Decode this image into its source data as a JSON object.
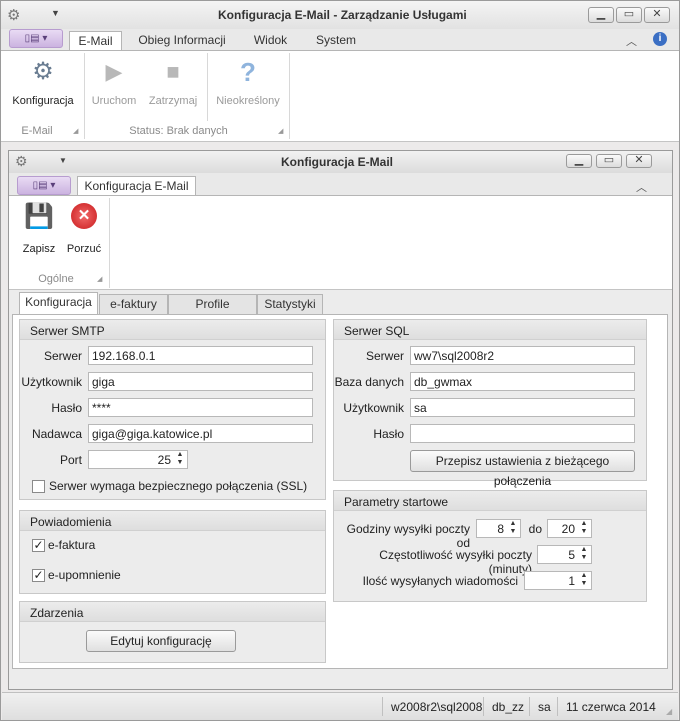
{
  "window": {
    "title_plain": "Konfiguracja E-Mail - ",
    "title_bold": "Zarządzanie Usługami"
  },
  "ribbon": {
    "tabs": [
      "E-Mail",
      "Obieg Informacji",
      "Widok",
      "System"
    ],
    "buttons": {
      "konfiguracja": "Konfiguracja",
      "uruchom": "Uruchom",
      "zatrzymaj": "Zatrzymaj",
      "nieokreslony": "Nieokreślony"
    },
    "groups": {
      "email": "E-Mail",
      "status": "Status: Brak danych"
    }
  },
  "child": {
    "title": "Konfiguracja E-Mail",
    "tab": "Konfiguracja E-Mail",
    "buttons": {
      "zapisz": "Zapisz",
      "porzuc": "Porzuć"
    },
    "group": "Ogólne"
  },
  "content_tabs": [
    "Konfiguracja",
    "e-faktury",
    "Profile upomnień",
    "Statystyki"
  ],
  "smtp": {
    "title": "Serwer SMTP",
    "labels": {
      "server": "Serwer",
      "user": "Użytkownik",
      "password": "Hasło",
      "sender": "Nadawca",
      "port": "Port"
    },
    "server": "192.168.0.1",
    "user": "giga",
    "password": "****",
    "sender": "giga@giga.katowice.pl",
    "port": "25",
    "ssl_label": "Serwer wymaga bezpiecznego połączenia (SSL)",
    "ssl_checked": false
  },
  "notif": {
    "title": "Powiadomienia",
    "efaktura": "e-faktura",
    "eupomnienie": "e-upomnienie",
    "efaktura_checked": true,
    "eupomnienie_checked": true
  },
  "events": {
    "title": "Zdarzenia",
    "edit_button": "Edytuj konfigurację"
  },
  "sql": {
    "title": "Serwer SQL",
    "labels": {
      "server": "Serwer",
      "database": "Baza danych",
      "user": "Użytkownik",
      "password": "Hasło"
    },
    "server": "ww7\\sql2008r2",
    "database": "db_gwmax",
    "user": "sa",
    "password": "",
    "copy_button": "Przepisz ustawienia z bieżącego połączenia"
  },
  "startup": {
    "title": "Parametry startowe",
    "hours_label": "Godziny wysyłki poczty od",
    "to_label": "do",
    "from": "8",
    "to": "20",
    "freq_label": "Częstotliwość wysyłki poczty (minuty)",
    "freq": "5",
    "count_label": "Ilość wysyłanych wiadomości",
    "count": "1"
  },
  "statusbar": {
    "server": "w2008r2\\sql2008",
    "db": "db_zz",
    "user": "sa",
    "date": "11 czerwca 2014"
  }
}
